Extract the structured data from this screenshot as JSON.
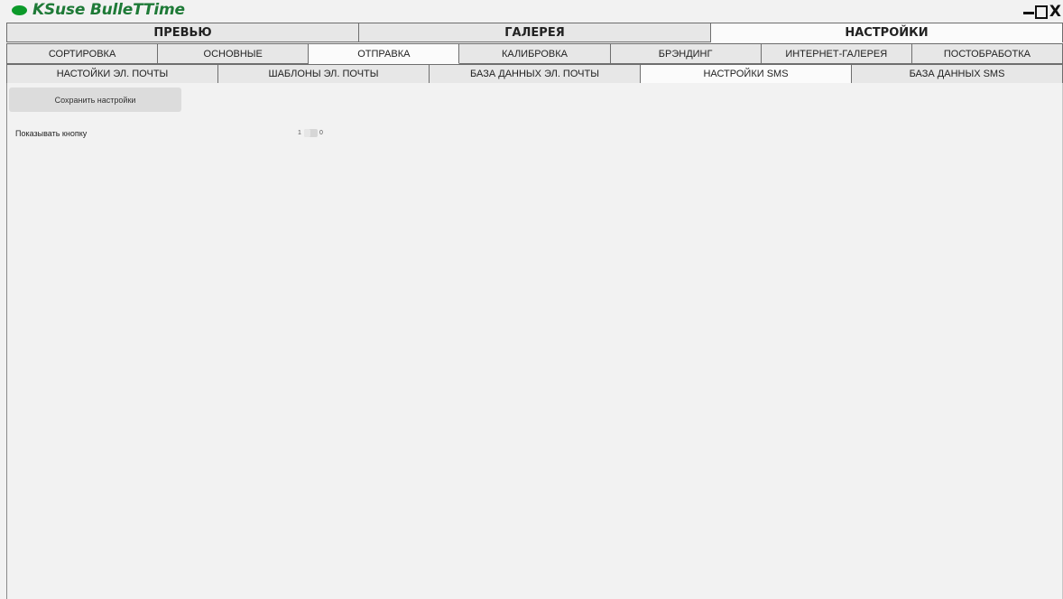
{
  "app": {
    "title": "KSuse BulleTTime",
    "logo_color": "#0c9a2a",
    "title_color": "#1e7a37",
    "window_controls": [
      "minimize-icon",
      "maximize-icon",
      "close-icon"
    ],
    "close_glyph": "X"
  },
  "main_tabs": [
    {
      "label": "ПРЕВЬЮ",
      "active": false
    },
    {
      "label": "ГАЛЕРЕЯ",
      "active": false
    },
    {
      "label": "НАСТРОЙКИ",
      "active": true
    }
  ],
  "settings_tabs": [
    {
      "label": "СОРТИРОВКА",
      "active": false
    },
    {
      "label": "ОСНОВНЫЕ",
      "active": false
    },
    {
      "label": "ОТПРАВКА",
      "active": true
    },
    {
      "label": "КАЛИБРОВКА",
      "active": false
    },
    {
      "label": "БРЭНДИНГ",
      "active": false
    },
    {
      "label": "ИНТЕРНЕТ-ГАЛЕРЕЯ",
      "active": false
    },
    {
      "label": "ПОСТОБРАБОТКА",
      "active": false
    }
  ],
  "send_tabs": [
    {
      "label": "НАСТОЙКИ ЭЛ. ПОЧТЫ",
      "active": false
    },
    {
      "label": "ШАБЛОНЫ ЭЛ. ПОЧТЫ",
      "active": false
    },
    {
      "label": "БАЗА ДАННЫХ ЭЛ. ПОЧТЫ",
      "active": false
    },
    {
      "label": "НАСТРОЙКИ SMS",
      "active": true
    },
    {
      "label": "БАЗА ДАННЫХ SMS",
      "active": false
    }
  ],
  "content": {
    "save_button": "Сохранить настройки",
    "show_button_label": "Показывать кнопку",
    "toggle": {
      "on_label": "1",
      "off_label": "0",
      "value": "0"
    }
  }
}
